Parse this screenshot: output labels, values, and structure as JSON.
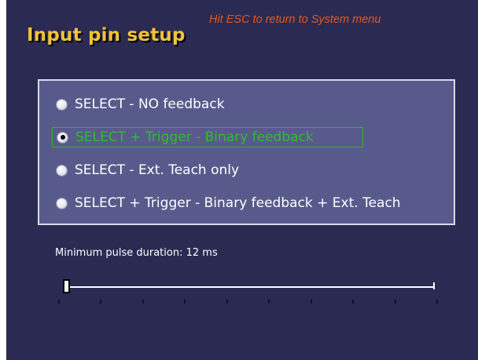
{
  "header": {
    "title": "Input pin setup",
    "hint": "Hit ESC to return to System menu"
  },
  "options": [
    {
      "label": "SELECT - NO feedback",
      "selected": false
    },
    {
      "label": "SELECT + Trigger - Binary feedback",
      "selected": true
    },
    {
      "label": "SELECT - Ext. Teach only",
      "selected": false
    },
    {
      "label": "SELECT + Trigger - Binary feedback + Ext. Teach",
      "selected": false
    }
  ],
  "pulse": {
    "label": "Minimum pulse duration:",
    "value": "12 ms",
    "level": 0
  },
  "colors": {
    "background": "#2a2a52",
    "panel": "#595a8c",
    "title": "#f2c23a",
    "hint": "#e8581a",
    "selected": "#2cbe2c"
  }
}
